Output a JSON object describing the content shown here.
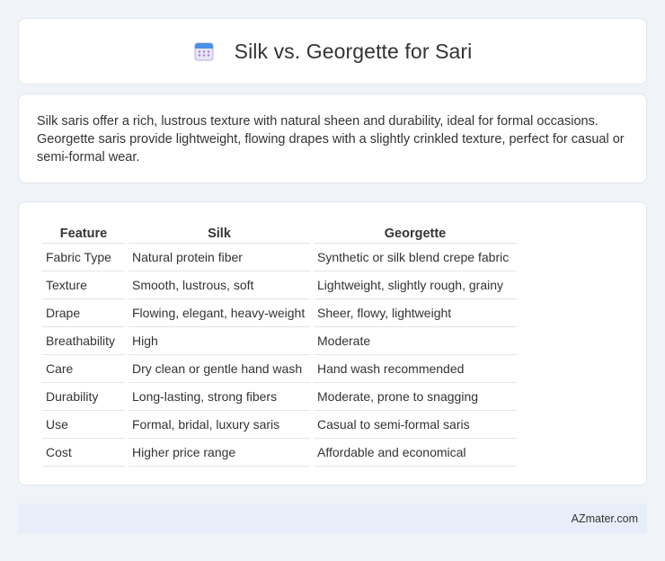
{
  "header": {
    "title": "Silk vs. Georgette for Sari",
    "icon": "calendar-icon"
  },
  "intro": {
    "text": "Silk saris offer a rich, lustrous texture with natural sheen and durability, ideal for formal occasions. Georgette saris provide lightweight, flowing drapes with a slightly crinkled texture, perfect for casual or semi-formal wear."
  },
  "table": {
    "headers": [
      "Feature",
      "Silk",
      "Georgette"
    ],
    "rows": [
      [
        "Fabric Type",
        "Natural protein fiber",
        "Synthetic or silk blend crepe fabric"
      ],
      [
        "Texture",
        "Smooth, lustrous, soft",
        "Lightweight, slightly rough, grainy"
      ],
      [
        "Drape",
        "Flowing, elegant, heavy-weight",
        "Sheer, flowy, lightweight"
      ],
      [
        "Breathability",
        "High",
        "Moderate"
      ],
      [
        "Care",
        "Dry clean or gentle hand wash",
        "Hand wash recommended"
      ],
      [
        "Durability",
        "Long-lasting, strong fibers",
        "Moderate, prone to snagging"
      ],
      [
        "Use",
        "Formal, bridal, luxury saris",
        "Casual to semi-formal saris"
      ],
      [
        "Cost",
        "Higher price range",
        "Affordable and economical"
      ]
    ]
  },
  "footer": {
    "text": "AZmater.com"
  }
}
